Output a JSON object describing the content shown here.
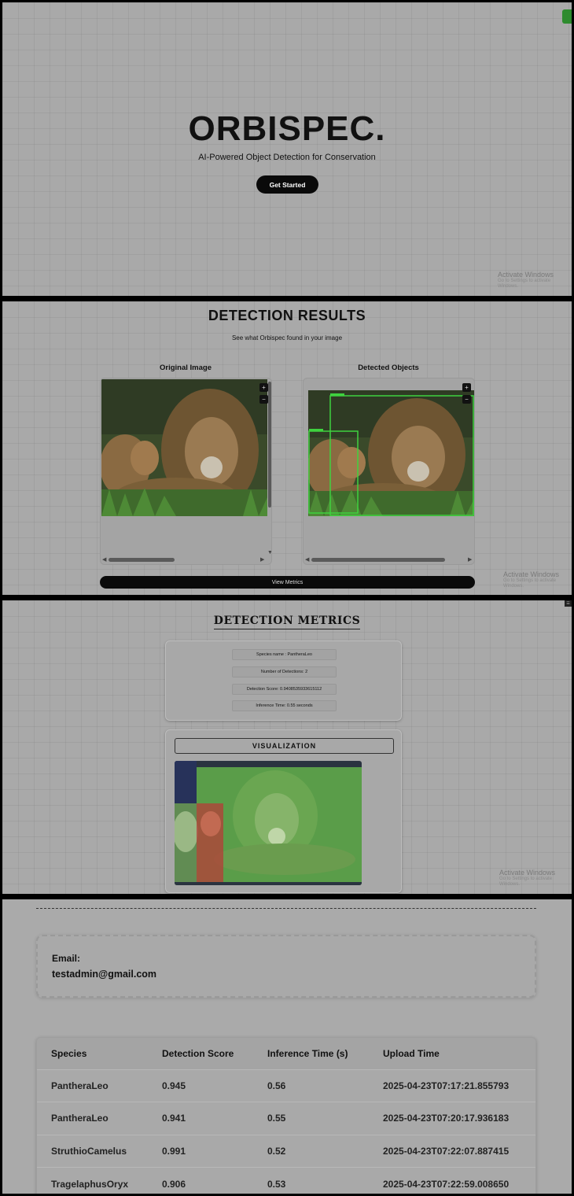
{
  "hero": {
    "brand": "ORBISPEC.",
    "tagline": "AI-Powered Object Detection for Conservation",
    "cta": "Get Started"
  },
  "activate_windows": {
    "title": "Activate Windows",
    "subtitle": "Go to Settings to activate Windows."
  },
  "results": {
    "title": "DETECTION RESULTS",
    "subtitle": "See what Orbispec found in your image",
    "original_label": "Original Image",
    "detected_label": "Detected Objects",
    "zoom_in": "+",
    "zoom_out": "−",
    "view_metrics": "View Metrics"
  },
  "metrics": {
    "title": "DETECTION METRICS",
    "species": "Species name : PantheraLeo",
    "detections": "Number of Detections: 2",
    "score": "Detection Score: 0.9408535933615112",
    "inference": "Inference Time: 0.55 seconds",
    "viz_title": "VISUALIZATION"
  },
  "account": {
    "email_label": "Email:",
    "email_value": "testadmin@gmail.com"
  },
  "history": {
    "headers": [
      "Species",
      "Detection Score",
      "Inference Time (s)",
      "Upload Time"
    ],
    "rows": [
      [
        "PantheraLeo",
        "0.945",
        "0.56",
        "2025-04-23T07:17:21.855793"
      ],
      [
        "PantheraLeo",
        "0.941",
        "0.55",
        "2025-04-23T07:20:17.936183"
      ],
      [
        "StruthioCamelus",
        "0.991",
        "0.52",
        "2025-04-23T07:22:07.887415"
      ],
      [
        "TragelaphusOryx",
        "0.906",
        "0.53",
        "2025-04-23T07:22:59.008650"
      ]
    ]
  },
  "colors": {
    "background": "#a9a9a9",
    "button": "#0a0a0a",
    "detection_box": "#3fd23f",
    "mask_green": "#5fa84a",
    "mask_red": "#b0443a"
  }
}
